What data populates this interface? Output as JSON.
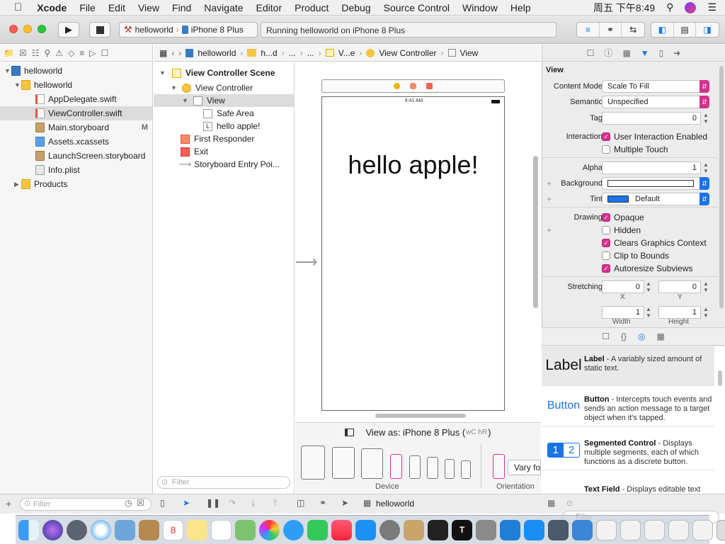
{
  "menubar": {
    "app_name": "Xcode",
    "items": [
      "File",
      "Edit",
      "View",
      "Find",
      "Navigate",
      "Editor",
      "Product",
      "Debug",
      "Source Control",
      "Window",
      "Help"
    ],
    "clock": "周五 下午8:49"
  },
  "toolbar": {
    "scheme": "helloworld",
    "device": "iPhone 8 Plus",
    "activity": "Running helloworld on iPhone 8 Plus"
  },
  "navigator": {
    "files": [
      {
        "label": "helloworld",
        "indent": 0,
        "kind": "project",
        "expanded": true
      },
      {
        "label": "helloworld",
        "indent": 1,
        "kind": "folder",
        "expanded": true
      },
      {
        "label": "AppDelegate.swift",
        "indent": 2,
        "kind": "swift"
      },
      {
        "label": "ViewController.swift",
        "indent": 2,
        "kind": "swift",
        "selected": true
      },
      {
        "label": "Main.storyboard",
        "indent": 2,
        "kind": "story",
        "badge": "M"
      },
      {
        "label": "Assets.xcassets",
        "indent": 2,
        "kind": "assets"
      },
      {
        "label": "LaunchScreen.storyboard",
        "indent": 2,
        "kind": "story"
      },
      {
        "label": "Info.plist",
        "indent": 2,
        "kind": "plist"
      },
      {
        "label": "Products",
        "indent": 1,
        "kind": "folder",
        "expanded": false
      }
    ],
    "filter_placeholder": "Filter"
  },
  "jumpbar": {
    "crumbs": [
      "helloworld",
      "h...d",
      "...",
      "...",
      "V...e",
      "View Controller",
      "View"
    ]
  },
  "outline": {
    "rows": [
      {
        "label": "View Controller Scene",
        "bold": true
      },
      {
        "label": "View Controller"
      },
      {
        "label": "View",
        "selected": true
      },
      {
        "label": "Safe Area"
      },
      {
        "label": "hello apple!"
      },
      {
        "label": "First Responder"
      },
      {
        "label": "Exit"
      },
      {
        "label": "Storyboard Entry Poi..."
      }
    ],
    "filter_placeholder": "Filter"
  },
  "canvas": {
    "status_time": "9:41 AM",
    "label_text": "hello apple!",
    "view_as": "View as: iPhone 8 Plus (",
    "size_class": "wC hR",
    "view_as_close": ")",
    "device_label": "Device",
    "orientation_label": "Orientation",
    "vary_button": "Vary for"
  },
  "inspector": {
    "section": "View",
    "content_mode_label": "Content Mode",
    "content_mode": "Scale To Fill",
    "semantic_label": "Semantic",
    "semantic": "Unspecified",
    "tag_label": "Tag",
    "tag": "0",
    "interaction_label": "Interaction",
    "user_interaction": "User Interaction Enabled",
    "multiple_touch": "Multiple Touch",
    "alpha_label": "Alpha",
    "alpha": "1",
    "background_label": "Background",
    "tint_label": "Tint",
    "tint": "Default",
    "drawing_label": "Drawing",
    "opaque": "Opaque",
    "hidden": "Hidden",
    "clears": "Clears Graphics Context",
    "clip": "Clip to Bounds",
    "autoresize": "Autoresize Subviews",
    "stretching_label": "Stretching",
    "stretch_x": "0",
    "stretch_y": "0",
    "x_label": "X",
    "y_label": "Y",
    "stretch_w": "1",
    "stretch_h": "1",
    "width_label": "Width",
    "height_label": "Height",
    "accent_color": "#d5318e",
    "tint_swatch": "#1a73e8"
  },
  "library": {
    "items": [
      {
        "icon_text": "Label",
        "name": "Label",
        "desc": " - A variably sized amount of static text."
      },
      {
        "icon_text": "Button",
        "name": "Button",
        "desc": " - Intercepts touch events and sends an action message to a target object when it's tapped."
      },
      {
        "icon_text": "1 2",
        "name": "Segmented Control",
        "desc": " - Displays multiple segments, each of which functions as a discrete button."
      },
      {
        "icon_text": "",
        "name": "Text Field",
        "desc": " - Displays editable text"
      }
    ],
    "filter_placeholder": "Filter"
  },
  "statusbar": {
    "scheme": "helloworld"
  }
}
